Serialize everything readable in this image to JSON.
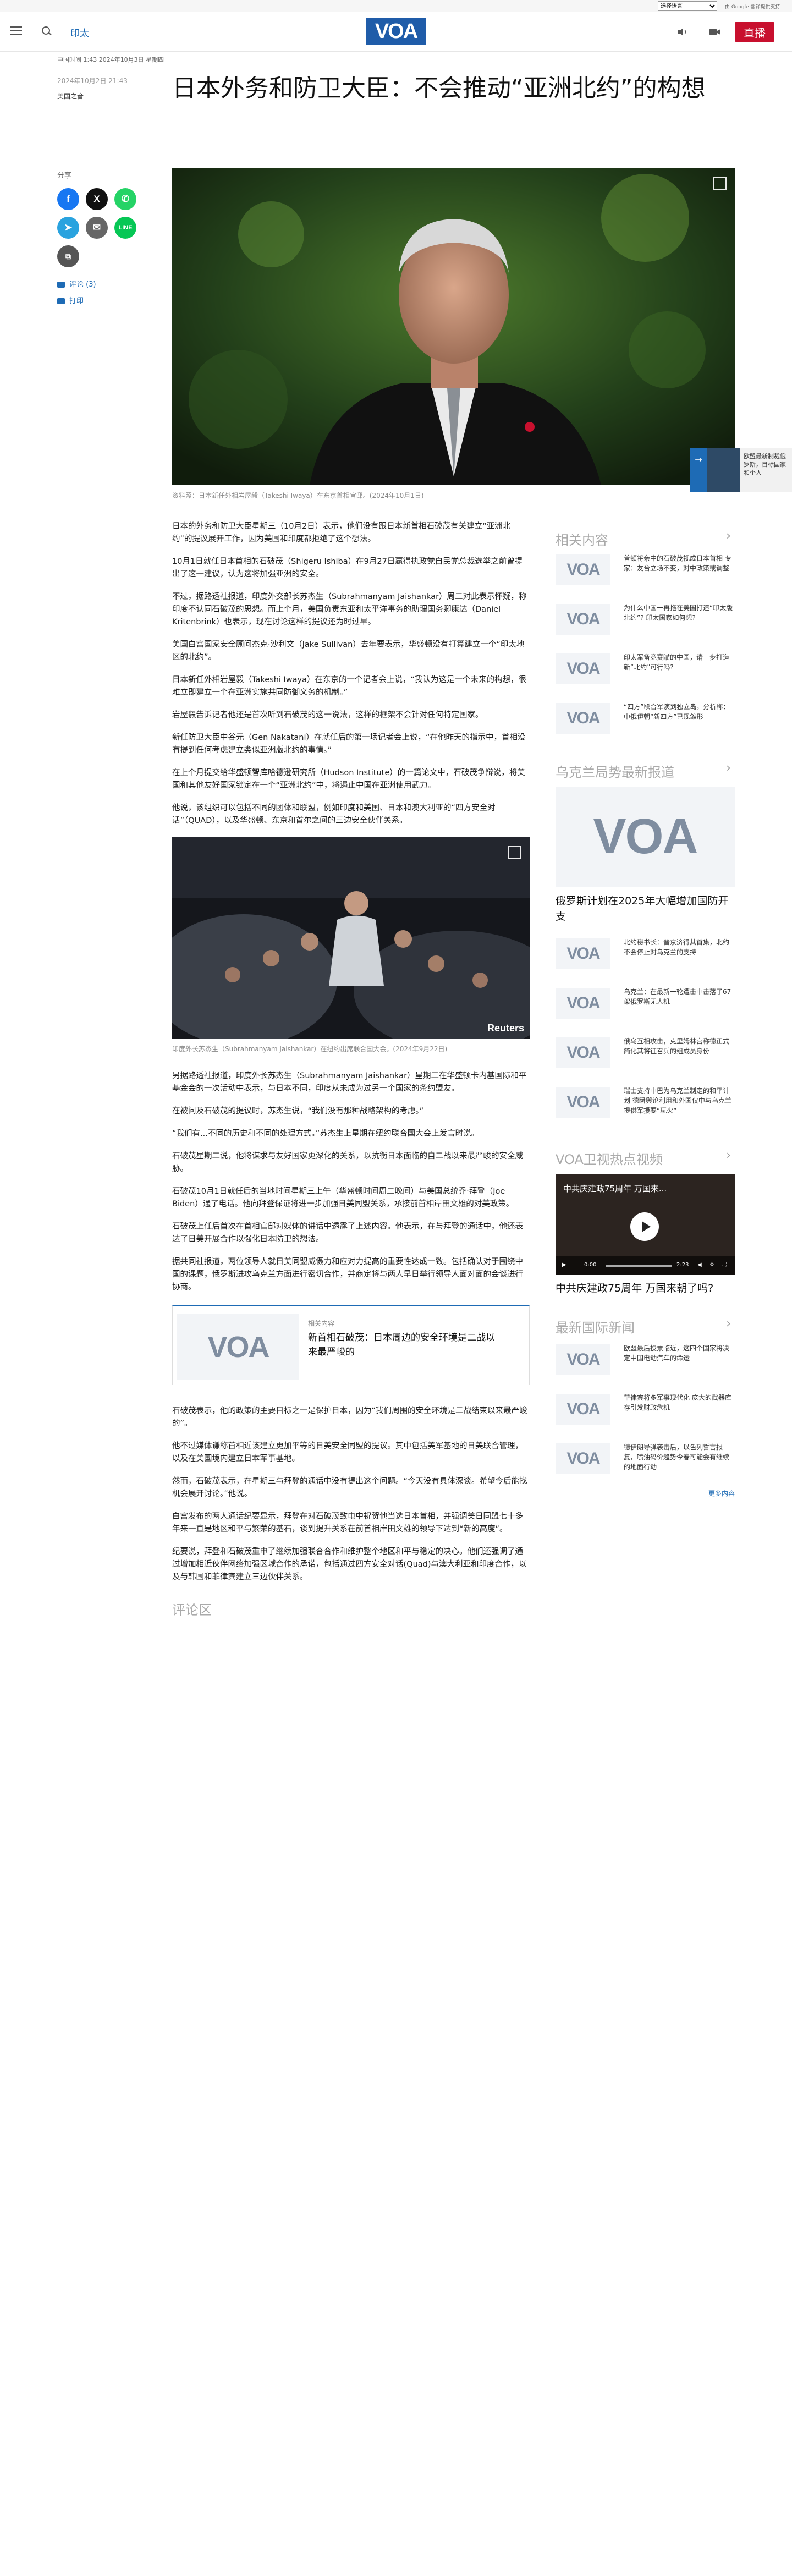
{
  "translate": {
    "select_label": "选择语言",
    "powered": "由 Google 翻译提供支持"
  },
  "header": {
    "section": "印太",
    "logo": "VOA",
    "live": "直播"
  },
  "article": {
    "dateline": "中国时间 1:43 2024年10月3日 星期四",
    "date": "2024年10月2日 21:43",
    "author": "美国之音",
    "title": "日本外务和防卫大臣：不会推动“亚洲北约”的构想",
    "lead_caption": "资料照：日本新任外相岩屋毅（Takeshi Iwaya）在东京首相官邸。(2024年10月1日)",
    "paragraphs_a": [
      "日本的外务和防卫大臣星期三（10月2日）表示，他们没有跟日本新首相石破茂有关建立“亚洲北约”的提议展开工作，因为美国和印度都拒绝了这个想法。",
      "10月1日就任日本首相的石破茂（Shigeru Ishiba）在9月27日赢得执政党自民党总裁选举之前曾提出了这一建议，认为这将加强亚洲的安全。",
      "不过，据路透社报道，印度外交部长苏杰生（Subrahmanyam Jaishankar）周二对此表示怀疑，称印度不认同石破茂的思想。而上个月，美国负责东亚和太平洋事务的助理国务卿康达（Daniel Kritenbrink）也表示，现在讨论这样的提议还为时过早。",
      "美国白宫国家安全顾问杰克·沙利文（Jake Sullivan）去年要表示，华盛顿没有打算建立一个“印太地区的北约”。",
      "日本新任外相岩屋毅（Takeshi Iwaya）在东京的一个记者会上说，“我认为这是一个未来的构想，很难立即建立一个在亚洲实施共同防御义务的机制。”",
      "岩屋毅告诉记者他还是首次听到石破茂的这一说法，这样的框架不会针对任何特定国家。",
      "新任防卫大臣中谷元（Gen Nakatani）在就任后的第一场记者会上说，“在他昨天的指示中，首相没有提到任何考虑建立类似亚洲版北约的事情。”",
      "在上个月提交给华盛顿智库哈德逊研究所（Hudson Institute）的一篇论文中，石破茂争辩说，将美国和其他友好国家锁定在一个“亚洲北约”中，将遏止中国在亚洲使用武力。",
      "他说，该组织可以包括不同的团体和联盟，例如印度和美国、日本和澳大利亚的“四方安全对话”（QUAD），以及华盛顿、东京和首尔之间的三边安全伙伴关系。"
    ],
    "inline_caption": "印度外长苏杰生（Subrahmanyam Jaishankar）在纽约出席联合国大会。(2024年9月22日)",
    "inline_credit": "Reuters",
    "paragraphs_b": [
      "另据路透社报道，印度外长苏杰生（Subrahmanyam Jaishankar）星期二在华盛顿卡内基国际和平基金会的一次活动中表示，与日本不同，印度从未成为过另一个国家的条约盟友。",
      "在被问及石破茂的提议时，苏杰生说，“我们没有那种战略架构的考虑。”",
      "“我们有...不同的历史和不同的处理方式。”苏杰生上星期在纽约联合国大会上发言时说。",
      "石破茂星期二说，他将谋求与友好国家更深化的关系，以抗衡日本面临的自二战以来最严峻的安全威胁。",
      "石破茂10月1日就任后的当地时间星期三上午（华盛顿时间周二晚间）与美国总统乔·拜登（Joe Biden）通了电话。他向拜登保证将进一步加强日美同盟关系，承接前首相岸田文雄的对美政策。",
      "石破茂上任后首次在首相官邸对媒体的讲话中透露了上述内容。他表示，在与拜登的通话中，他还表达了日美开展合作以强化日本防卫的想法。",
      "据共同社报道，两位领导人就日美同盟威慑力和应对力提高的重要性达成一致。包括确认对于围绕中国的课题，俄罗斯进攻乌克兰方面进行密切合作，并商定将与两人早日举行领导人面对面的会谈进行协商。"
    ],
    "related_label": "相关内容",
    "related_title": "新首相石破茂：日本周边的安全环境是二战以来最严峻的",
    "paragraphs_c": [
      "石破茂表示，他的政策的主要目标之一是保护日本，因为“我们周围的安全环境是二战结束以来最严峻的”。",
      "他不过媒体谦称首相近该建立更加平等的日美安全同盟的提议。其中包括美军基地的日美联合管理，以及在美国境内建立日本军事基地。",
      "然而，石破茂表示，在星期三与拜登的通话中没有提出这个问题。“今天没有具体深谈。希望今后能找机会展开讨论。”他说。",
      "白宫发布的两人通话纪要显示，拜登在对石破茂致电中祝贺他当选日本首相，并强调美日同盟七十多年来一直是地区和平与繁荣的基石，谈到提升关系在前首相岸田文雄的领导下达到“新的高度”。",
      "纪要说，拜登和石破茂重申了继续加强联合合作和维护整个地区和平与稳定的决心。他们还强调了通过增加相近伙伴网络加强区域合作的承诺，包括通过四方安全对话(Quad)与澳大利亚和印度合作，以及与韩国和菲律宾建立三边伙伴关系。"
    ],
    "comments_label": "评论区"
  },
  "share": {
    "label": "分享",
    "comments_link": "评论 (3)",
    "print_link": "打印"
  },
  "float_widget": {
    "text": "欧盟最新制裁俄罗斯，目标国家和个人"
  },
  "sidebar": {
    "related_title": "相关内容",
    "related": [
      "普顿将亲中的石破茂视成日本首相 专家：友台立场不变，对中政策或调整",
      "为什么中国一再拖在美国打造“印太版北约”? 印太国家如何想?",
      "印太军备竞赛瞄的中国，请一步打造新“北约”可行吗?",
      "“四方”联合军演到独立岛，分析称：中俄伊朝“新四方”已现雏形"
    ],
    "ukraine_title": "乌克兰局势最新报道",
    "ukraine_big": "俄罗斯计划在2025年大幅增加国防开支",
    "ukraine": [
      "北约秘书长：普京济得其首集，北约不会停止对乌克兰的支持",
      "乌克兰：在最新一轮遭击中击落了67架俄罗斯无人机",
      "俄乌互相攻击，克里姆林宫称德正式简化其将征召兵的组成员身份",
      "瑞士支持中巴为乌克兰制定的和平计划 德瞬舆论利用和外国仅中与乌克兰提供军援要“玩火”"
    ],
    "video_title": "VOA卫视热点视频",
    "video_overlay": "中共庆建政75周年 万国来...",
    "video_time_start": "0:00",
    "video_time_end": "2:23",
    "video_caption": "中共庆建政75周年 万国来朝了吗?",
    "intl_title": "最新国际新闻",
    "intl": [
      "欧盟最后投票临近，这四个国家将决定中国电动汽车的命运",
      "菲律宾将多军事现代化 庞大的武器库存引发财政危机",
      "德伊朗导弹袭击后，以色列誓言报复，喷油码价趋势今春可能会有继续的地面行动"
    ],
    "more": "更多内容"
  }
}
